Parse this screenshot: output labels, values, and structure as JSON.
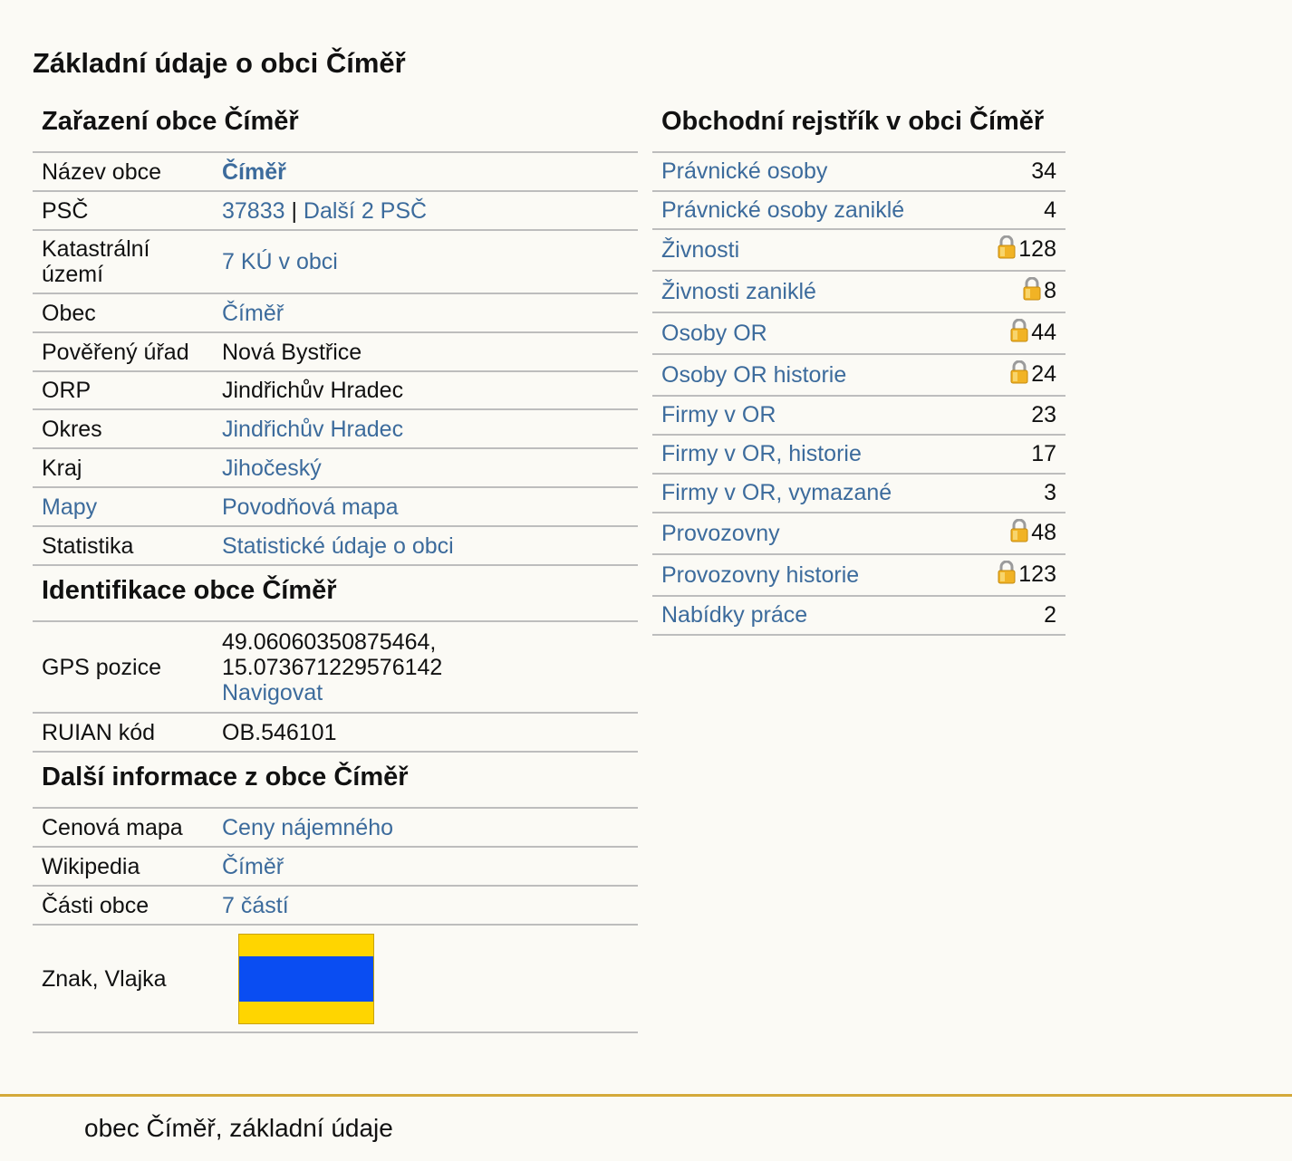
{
  "page_title": "Základní údaje o obci Číměř",
  "zarazeni": {
    "title": "Zařazení obce Číměř",
    "rows": {
      "nazev": {
        "label": "Název obce",
        "value": "Číměř"
      },
      "psc": {
        "label": "PSČ",
        "value": "37833",
        "sep": " | ",
        "more": "Další 2 PSČ"
      },
      "ku": {
        "label": "Katastrální území",
        "value": "7 KÚ v obci"
      },
      "obec": {
        "label": "Obec",
        "value": "Číměř"
      },
      "povereny": {
        "label": "Pověřený úřad",
        "value": "Nová Bystřice"
      },
      "orp": {
        "label": "ORP",
        "value": "Jindřichův Hradec"
      },
      "okres": {
        "label": "Okres",
        "value": "Jindřichův Hradec"
      },
      "kraj": {
        "label": "Kraj",
        "value": "Jihočeský"
      },
      "mapy": {
        "label": "Mapy",
        "value": "Povodňová mapa"
      },
      "statistika": {
        "label": "Statistika",
        "value": "Statistické údaje o obci"
      }
    }
  },
  "identifikace": {
    "title": "Identifikace obce Číměř",
    "gps": {
      "label": "GPS pozice",
      "lat": "49.06060350875464,",
      "lon": "15.073671229576142",
      "nav": "Navigovat"
    },
    "ruian": {
      "label": "RUIAN kód",
      "value": "OB.546101"
    }
  },
  "dalsi": {
    "title": "Další informace z obce Číměř",
    "cenova": {
      "label": "Cenová mapa",
      "value": "Ceny nájemného"
    },
    "wiki": {
      "label": "Wikipedia",
      "value": "Číměř"
    },
    "casti": {
      "label": "Části obce",
      "value": "7 částí"
    },
    "znak": {
      "label": "Znak, Vlajka"
    },
    "flag_colors": [
      "#ffd500",
      "#0a4df2",
      "#ffd500"
    ]
  },
  "rejstrik": {
    "title": "Obchodní rejstřík v obci Číměř",
    "rows": [
      {
        "label": "Právnické osoby",
        "count": "34",
        "locked": false
      },
      {
        "label": "Právnické osoby zaniklé",
        "count": "4",
        "locked": false
      },
      {
        "label": "Živnosti",
        "count": "128",
        "locked": true
      },
      {
        "label": "Živnosti zaniklé",
        "count": "8",
        "locked": true
      },
      {
        "label": "Osoby OR",
        "count": "44",
        "locked": true
      },
      {
        "label": "Osoby OR historie",
        "count": "24",
        "locked": true
      },
      {
        "label": "Firmy v OR",
        "count": "23",
        "locked": false
      },
      {
        "label": "Firmy v OR, historie",
        "count": "17",
        "locked": false
      },
      {
        "label": "Firmy v OR, vymazané",
        "count": "3",
        "locked": false
      },
      {
        "label": "Provozovny",
        "count": "48",
        "locked": true
      },
      {
        "label": "Provozovny historie",
        "count": "123",
        "locked": true
      },
      {
        "label": "Nabídky práce",
        "count": "2",
        "locked": false
      }
    ],
    "lock_icon": "padlock-icon"
  },
  "footer": {
    "text": "obec Číměř, základní údaje",
    "accent": "#d4a93a"
  }
}
